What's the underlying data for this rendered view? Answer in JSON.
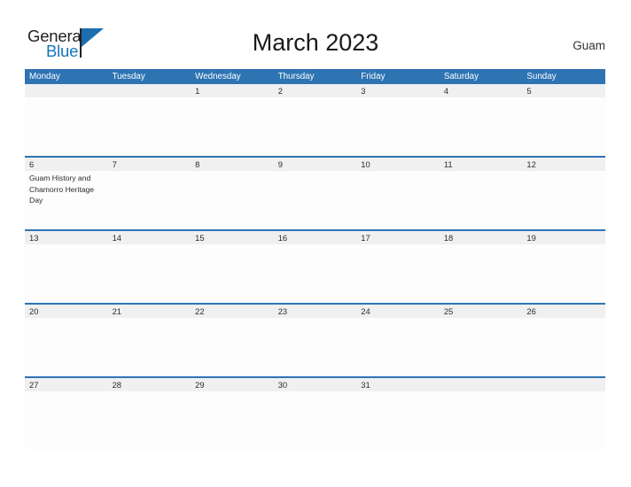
{
  "brand": {
    "name_part1": "General",
    "name_part2": "Blue",
    "triangle_icon": "triangle-icon",
    "accent_color": "#1276bd"
  },
  "header": {
    "title": "March 2023",
    "region": "Guam"
  },
  "colors": {
    "header_blue": "#2e74b3",
    "row_band_gray": "#f0f0f0",
    "text_dark": "#2b2b2b"
  },
  "calendar": {
    "day_headers": [
      "Monday",
      "Tuesday",
      "Wednesday",
      "Thursday",
      "Friday",
      "Saturday",
      "Sunday"
    ],
    "weeks": [
      {
        "days": [
          {
            "number": "",
            "events": []
          },
          {
            "number": "",
            "events": []
          },
          {
            "number": "1",
            "events": []
          },
          {
            "number": "2",
            "events": []
          },
          {
            "number": "3",
            "events": []
          },
          {
            "number": "4",
            "events": []
          },
          {
            "number": "5",
            "events": []
          }
        ]
      },
      {
        "days": [
          {
            "number": "6",
            "events": [
              "Guam History and Chamorro Heritage Day"
            ]
          },
          {
            "number": "7",
            "events": []
          },
          {
            "number": "8",
            "events": []
          },
          {
            "number": "9",
            "events": []
          },
          {
            "number": "10",
            "events": []
          },
          {
            "number": "11",
            "events": []
          },
          {
            "number": "12",
            "events": []
          }
        ]
      },
      {
        "days": [
          {
            "number": "13",
            "events": []
          },
          {
            "number": "14",
            "events": []
          },
          {
            "number": "15",
            "events": []
          },
          {
            "number": "16",
            "events": []
          },
          {
            "number": "17",
            "events": []
          },
          {
            "number": "18",
            "events": []
          },
          {
            "number": "19",
            "events": []
          }
        ]
      },
      {
        "days": [
          {
            "number": "20",
            "events": []
          },
          {
            "number": "21",
            "events": []
          },
          {
            "number": "22",
            "events": []
          },
          {
            "number": "23",
            "events": []
          },
          {
            "number": "24",
            "events": []
          },
          {
            "number": "25",
            "events": []
          },
          {
            "number": "26",
            "events": []
          }
        ]
      },
      {
        "days": [
          {
            "number": "27",
            "events": []
          },
          {
            "number": "28",
            "events": []
          },
          {
            "number": "29",
            "events": []
          },
          {
            "number": "30",
            "events": []
          },
          {
            "number": "31",
            "events": []
          },
          {
            "number": "",
            "events": []
          },
          {
            "number": "",
            "events": []
          }
        ]
      }
    ]
  }
}
